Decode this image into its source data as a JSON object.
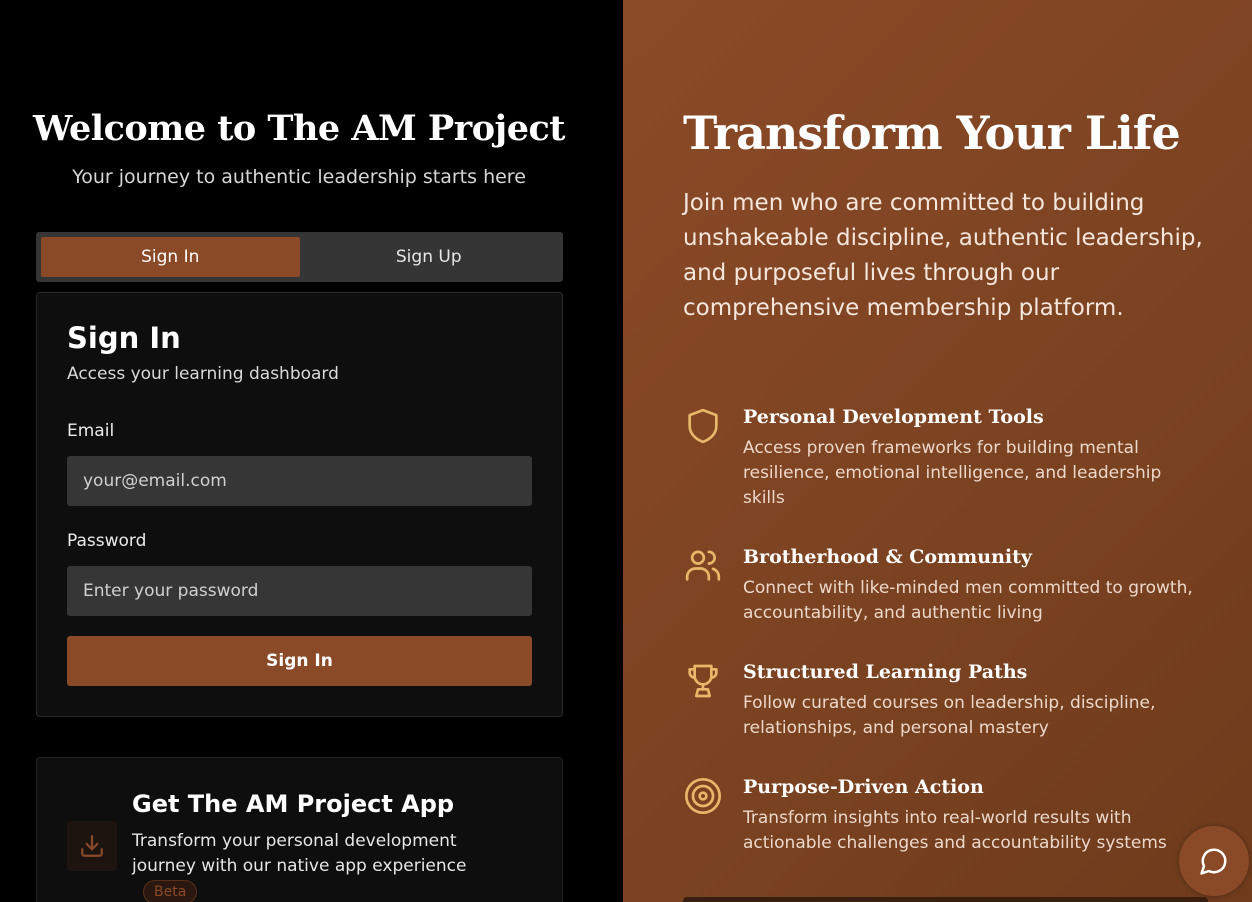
{
  "welcome": {
    "title": "Welcome to The AM Project",
    "subtitle": "Your journey to authentic leadership starts here"
  },
  "tabs": [
    {
      "label": "Sign In",
      "active": true
    },
    {
      "label": "Sign Up",
      "active": false
    }
  ],
  "signin": {
    "title": "Sign In",
    "subtitle": "Access your learning dashboard",
    "email_label": "Email",
    "email_placeholder": "your@email.com",
    "password_label": "Password",
    "password_placeholder": "Enter your password",
    "button_label": "Sign In"
  },
  "app_promo": {
    "title": "Get The AM Project App",
    "description": "Transform your personal development journey with our native app experience",
    "badge": "Beta",
    "icon": "download-icon"
  },
  "hero": {
    "title": "Transform Your Life",
    "description": "Join men who are committed to building unshakeable discipline, authentic leadership, and purposeful lives through our comprehensive membership platform."
  },
  "features": [
    {
      "icon": "shield-icon",
      "title": "Personal Development Tools",
      "description": "Access proven frameworks for building mental resilience, emotional intelligence, and leadership skills"
    },
    {
      "icon": "users-icon",
      "title": "Brotherhood & Community",
      "description": "Connect with like-minded men committed to growth, accountability, and authentic living"
    },
    {
      "icon": "trophy-icon",
      "title": "Structured Learning Paths",
      "description": "Follow curated courses on leadership, discipline, relationships, and personal mastery"
    },
    {
      "icon": "target-icon",
      "title": "Purpose-Driven Action",
      "description": "Transform insights into real-world results with actionable challenges and accountability systems"
    }
  ],
  "colors": {
    "accent": "#8b4a27",
    "icon_gold": "#e8b86a",
    "input_bg": "#363636"
  },
  "chat": {
    "icon": "chat-bubble-icon"
  }
}
